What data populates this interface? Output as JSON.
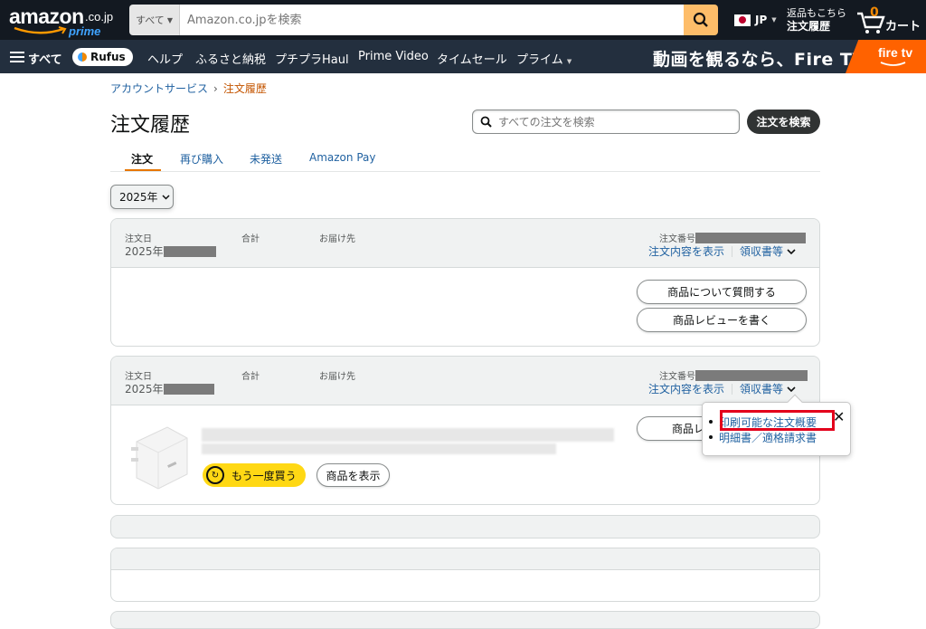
{
  "header": {
    "logo_text": "amazon",
    "logo_tld": ".co.jp",
    "logo_prime": "prime",
    "search_category": "すべて",
    "search_placeholder": "Amazon.co.jpを検索",
    "language": "JP",
    "returns_line1": "返品もこちら",
    "returns_line2": "注文履歴",
    "cart_count": "0",
    "cart_label": "カート"
  },
  "subnav": {
    "all": "すべて",
    "rufus": "Rufus",
    "items": [
      "ヘルプ",
      "ふるさと納税",
      "プチプラHaul",
      "Prime Video",
      "タイムセール",
      "プライム"
    ],
    "promo": "動画を観るなら、Fire TV",
    "fire_tv": "fire tv"
  },
  "breadcrumb": {
    "account": "アカウントサービス",
    "current": "注文履歴",
    "sep": "›"
  },
  "page": {
    "title": "注文履歴",
    "search_placeholder": "すべての注文を検索",
    "search_button": "注文を検索"
  },
  "tabs": [
    "注文",
    "再び購入",
    "未発送",
    "Amazon Pay"
  ],
  "year_filter": "2025年",
  "orders": [
    {
      "date_label": "注文日",
      "date_value": "2025年",
      "total_label": "合計",
      "ship_label": "お届け先",
      "number_label": "注文番号",
      "details_link": "注文内容を表示",
      "receipt_link": "領収書等",
      "button1": "商品について質問する",
      "button2": "商品レビューを書く"
    },
    {
      "date_label": "注文日",
      "date_value": "2025年",
      "total_label": "合計",
      "ship_label": "お届け先",
      "number_label": "注文番号",
      "details_link": "注文内容を表示",
      "receipt_link": "領収書等",
      "button1": "商品レ",
      "buy_again": "もう一度買う",
      "view_item": "商品を表示"
    }
  ],
  "popover": {
    "item1": "印刷可能な注文概要",
    "item2": "明細書／適格請求書",
    "close": "✕"
  },
  "colors": {
    "nav_dark": "#131921",
    "nav_sub": "#232f3e",
    "search_button": "#febd69",
    "link": "#2162a1",
    "tab_accent": "#e77600",
    "buy_again": "#ffd814",
    "highlight": "#e3001b"
  }
}
